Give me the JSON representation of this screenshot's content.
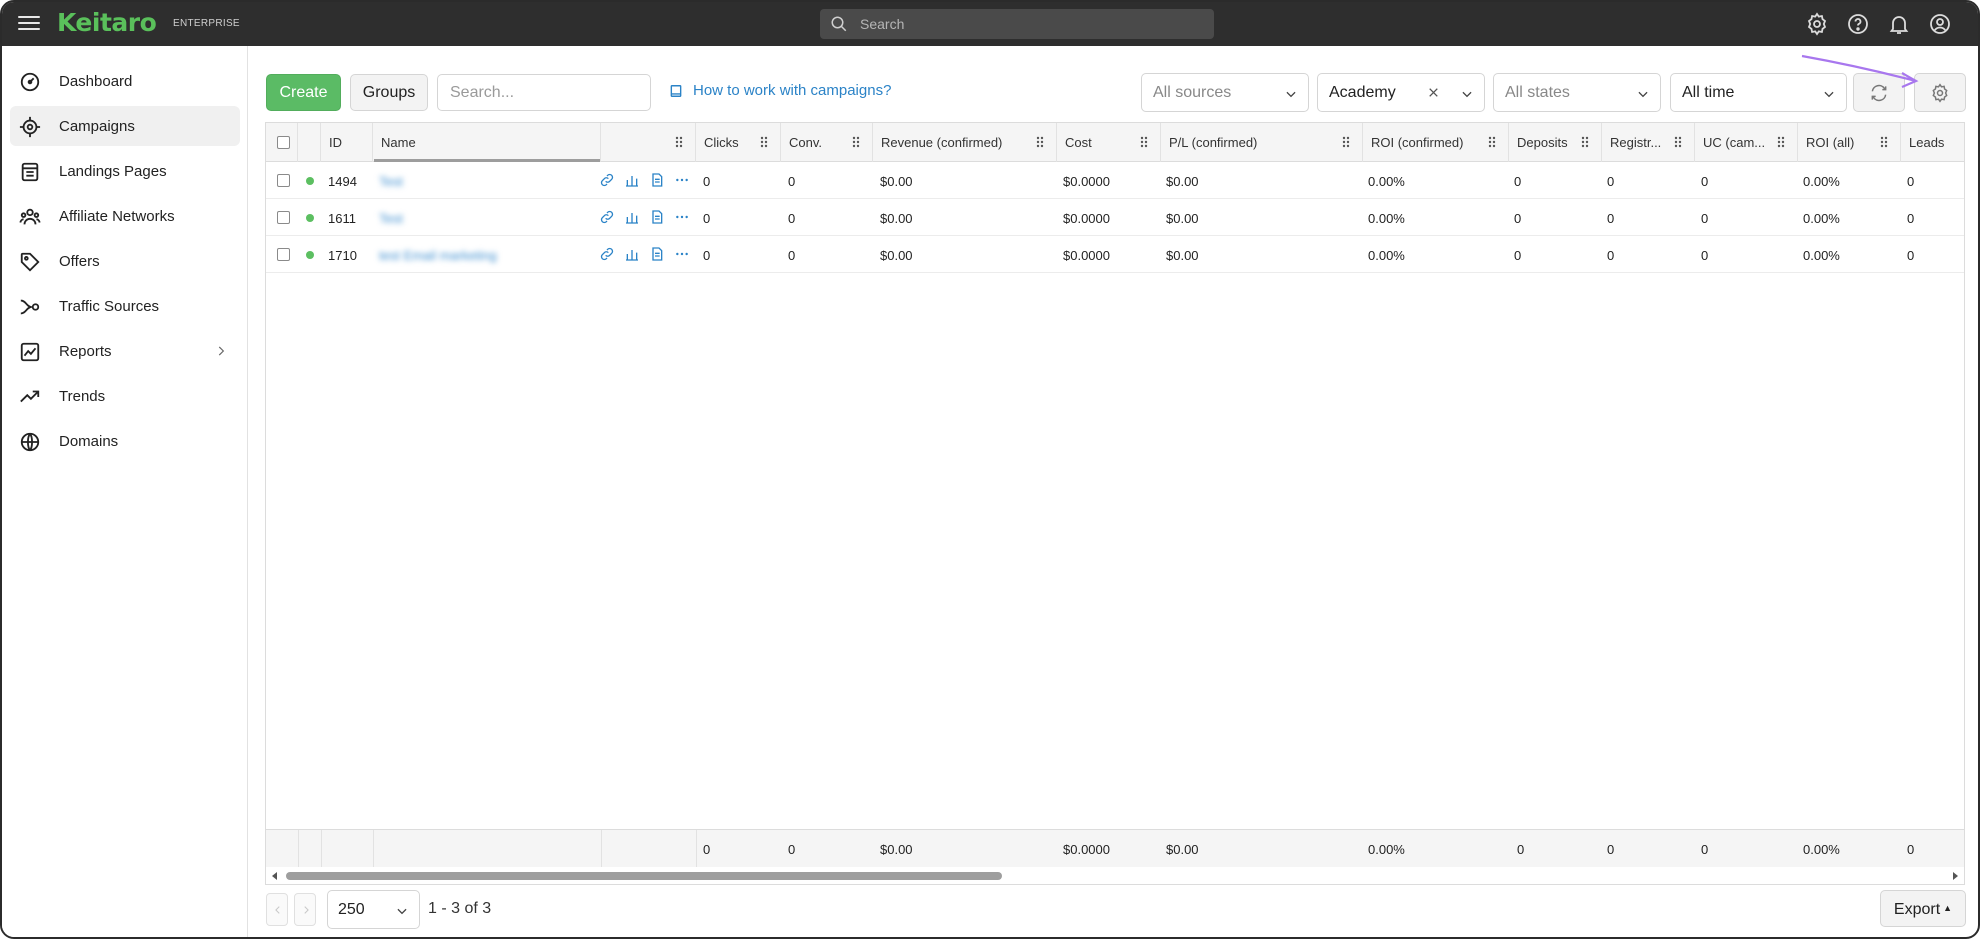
{
  "app": {
    "logo": "Keitaro",
    "edition": "ENTERPRISE",
    "search_placeholder": "Search"
  },
  "topbar": {
    "icons": [
      "gear-icon",
      "help-icon",
      "bell-icon",
      "user-icon"
    ]
  },
  "sidebar": {
    "items": [
      {
        "label": "Dashboard",
        "icon": "dashboard-icon"
      },
      {
        "label": "Campaigns",
        "icon": "target-icon",
        "active": true
      },
      {
        "label": "Landings Pages",
        "icon": "landing-icon"
      },
      {
        "label": "Affiliate Networks",
        "icon": "network-icon"
      },
      {
        "label": "Offers",
        "icon": "tag-icon"
      },
      {
        "label": "Traffic Sources",
        "icon": "source-icon"
      },
      {
        "label": "Reports",
        "icon": "report-icon",
        "has_submenu": true
      },
      {
        "label": "Trends",
        "icon": "trend-icon"
      },
      {
        "label": "Domains",
        "icon": "globe-icon"
      }
    ]
  },
  "toolbar": {
    "create_label": "Create",
    "groups_label": "Groups",
    "search_placeholder": "Search...",
    "help_link": "How to work with campaigns?",
    "filters": {
      "sources": "All sources",
      "group": "Academy",
      "states": "All states",
      "period": "All time"
    }
  },
  "table": {
    "columns": [
      "ID",
      "Name",
      "Clicks",
      "Conv.",
      "Revenue (confirmed)",
      "Cost",
      "P/L (confirmed)",
      "ROI (confirmed)",
      "Deposits",
      "Registr...",
      "UC (cam...",
      "ROI (all)",
      "Leads"
    ],
    "rows": [
      {
        "id": "1494",
        "name": "Test",
        "clicks": "0",
        "conv": "0",
        "revenue": "$0.00",
        "cost": "$0.0000",
        "pl": "$0.00",
        "roi": "0.00%",
        "deposits": "0",
        "registr": "0",
        "uc": "0",
        "roi_all": "0.00%",
        "leads": "0",
        "status_color": "#5cbf61"
      },
      {
        "id": "1611",
        "name": "Test",
        "clicks": "0",
        "conv": "0",
        "revenue": "$0.00",
        "cost": "$0.0000",
        "pl": "$0.00",
        "roi": "0.00%",
        "deposits": "0",
        "registr": "0",
        "uc": "0",
        "roi_all": "0.00%",
        "leads": "0",
        "status_color": "#5cbf61"
      },
      {
        "id": "1710",
        "name": "test Email marketing",
        "clicks": "0",
        "conv": "0",
        "revenue": "$0.00",
        "cost": "$0.0000",
        "pl": "$0.00",
        "roi": "0.00%",
        "deposits": "0",
        "registr": "0",
        "uc": "0",
        "roi_all": "0.00%",
        "leads": "0",
        "status_color": "#5cbf61"
      }
    ],
    "totals": {
      "clicks": "0",
      "conv": "0",
      "revenue": "$0.00",
      "cost": "$0.0000",
      "pl": "$0.00",
      "roi": "0.00%",
      "deposits": "0",
      "registr": "0",
      "uc": "0",
      "roi_all": "0.00%",
      "leads": "0"
    }
  },
  "pagination": {
    "page_size": "250",
    "range": "1 - 3 of 3"
  },
  "export_label": "Export",
  "colors": {
    "brand": "#5ac05b",
    "link": "#2b83c7",
    "annotation": "#a877ee"
  }
}
